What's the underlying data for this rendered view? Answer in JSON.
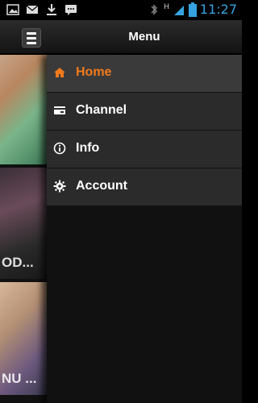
{
  "status_bar": {
    "time": "11:27",
    "network_type": "H",
    "icons": [
      "image-notification-icon",
      "mail-icon",
      "download-icon",
      "chat-icon",
      "bluetooth-icon",
      "signal-icon",
      "battery-icon"
    ]
  },
  "header": {
    "title": "Menu"
  },
  "menu": {
    "items": [
      {
        "label": "Home",
        "icon": "home-icon",
        "active": true
      },
      {
        "label": "Channel",
        "icon": "channel-icon",
        "active": false
      },
      {
        "label": "Info",
        "icon": "info-icon",
        "active": false
      },
      {
        "label": "Account",
        "icon": "gear-icon",
        "active": false
      }
    ]
  },
  "preview": {
    "thumb2_text": "OD...",
    "thumb3_text": "NU ..."
  },
  "colors": {
    "accent": "#f07a1c",
    "clock": "#36a3e0"
  }
}
